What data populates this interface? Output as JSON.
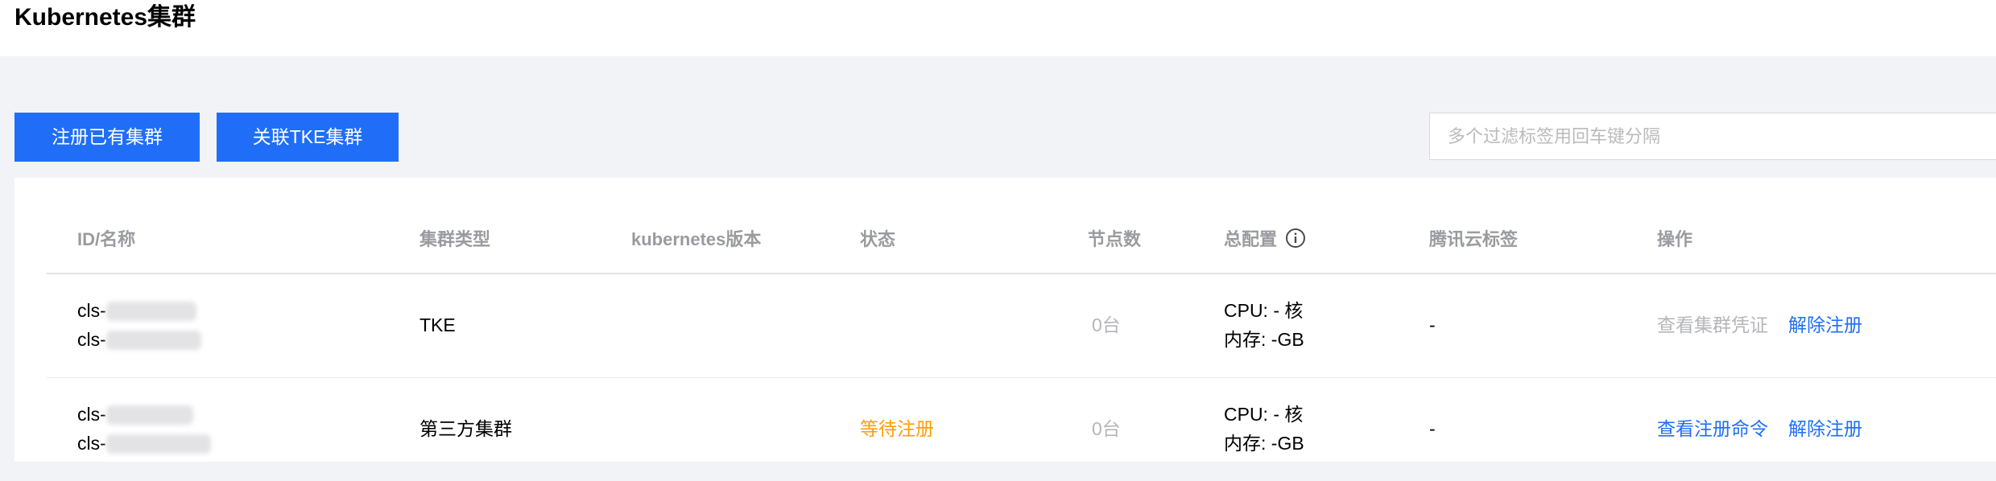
{
  "page": {
    "title": "Kubernetes集群"
  },
  "toolbar": {
    "register_label": "注册已有集群",
    "link_label": "关联TKE集群",
    "search_placeholder": "多个过滤标签用回车键分隔"
  },
  "table": {
    "columns": [
      "ID/名称",
      "集群类型",
      "kubernetes版本",
      "状态",
      "节点数",
      "总配置",
      "腾讯云标签",
      "操作"
    ],
    "rows": [
      {
        "id_prefix": "cls-",
        "name_prefix": "cls-",
        "type": "TKE",
        "version": "",
        "status": "",
        "nodes": "0台",
        "cpu": "CPU: - 核",
        "memory": "内存: -GB",
        "tags": "-",
        "action_primary": "查看集群凭证",
        "action_secondary": "解除注册"
      },
      {
        "id_prefix": "cls-",
        "name_prefix": "cls-",
        "type": "第三方集群",
        "version": "",
        "status": "等待注册",
        "nodes": "0台",
        "cpu": "CPU: - 核",
        "memory": "内存: -GB",
        "tags": "-",
        "action_primary": "查看注册命令",
        "action_secondary": "解除注册"
      }
    ]
  },
  "colors": {
    "primary": "#206ef7",
    "link": "#1f6ef7",
    "warning": "#ff9d00",
    "muted": "#b5b6ba",
    "header_text": "#9a9ba0",
    "background": "#f2f3f7"
  },
  "icons": {
    "config_info": "info-circle-icon"
  }
}
